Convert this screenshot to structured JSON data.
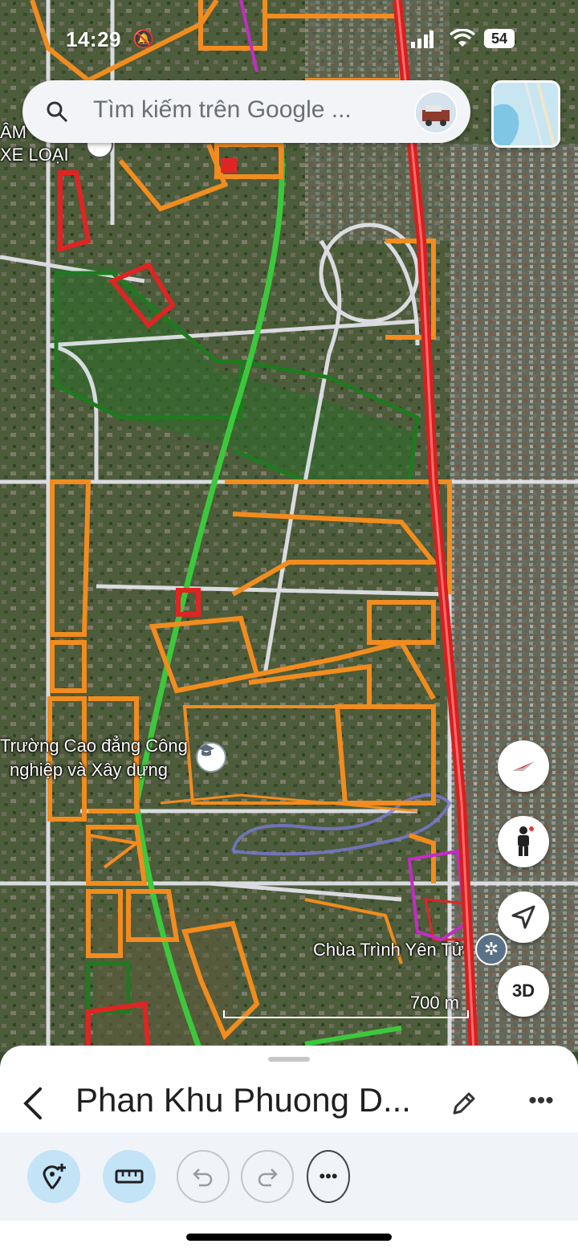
{
  "status_bar": {
    "time": "14:29",
    "battery": "54"
  },
  "search": {
    "placeholder": "Tìm kiếm trên Google ..."
  },
  "map": {
    "labels": {
      "top_left_1": "ÂM",
      "top_left_2": "XE LOẠI",
      "college_1": "Trường Cao đẳng Công",
      "college_2": "nghiệp và Xây dựng",
      "pagoda": "Chùa Trình Yên Tử"
    },
    "scale": "700 m",
    "colors": {
      "boundary_orange": "#f28c1e",
      "boundary_red": "#e02424",
      "boundary_green": "#1f7a1f",
      "highway_red": "#d62020",
      "main_green": "#3cc83c",
      "road_white": "#e9e9f2"
    }
  },
  "controls": {
    "btn_3d": "3D"
  },
  "sheet": {
    "title": "Phan Khu Phuong D..."
  }
}
